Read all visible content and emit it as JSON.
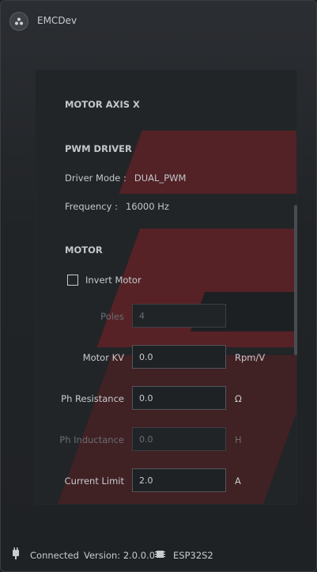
{
  "window": {
    "title": "EMCDev"
  },
  "panel": {
    "title": "MOTOR AXIS X",
    "pwm": {
      "heading": "PWM DRIVER",
      "driver_mode_label": "Driver Mode :",
      "driver_mode_value": "DUAL_PWM",
      "frequency_label": "Frequency :",
      "frequency_value": "16000 Hz"
    },
    "motor": {
      "heading": "MOTOR",
      "invert_label": "Invert Motor",
      "invert_checked": false,
      "fields": [
        {
          "label": "Poles",
          "value": "4",
          "unit": "",
          "enabled": false
        },
        {
          "label": "Motor KV",
          "value": "0.0",
          "unit": "Rpm/V",
          "enabled": true
        },
        {
          "label": "Ph Resistance",
          "value": "0.0",
          "unit": "Ω",
          "enabled": true
        },
        {
          "label": "Ph Inductance",
          "value": "0.0",
          "unit": "H",
          "enabled": false
        },
        {
          "label": "Current Limit",
          "value": "2.0",
          "unit": "A",
          "enabled": true
        }
      ]
    }
  },
  "status": {
    "connection": "Connected",
    "version": "Version: 2.0.0.0",
    "device": "ESP32S2"
  },
  "icons": {
    "app": "app-logo-icon",
    "usb": "usb-plug-icon",
    "chip": "chip-icon"
  },
  "colors": {
    "accent": "#8e1e22",
    "background": "#222528"
  }
}
